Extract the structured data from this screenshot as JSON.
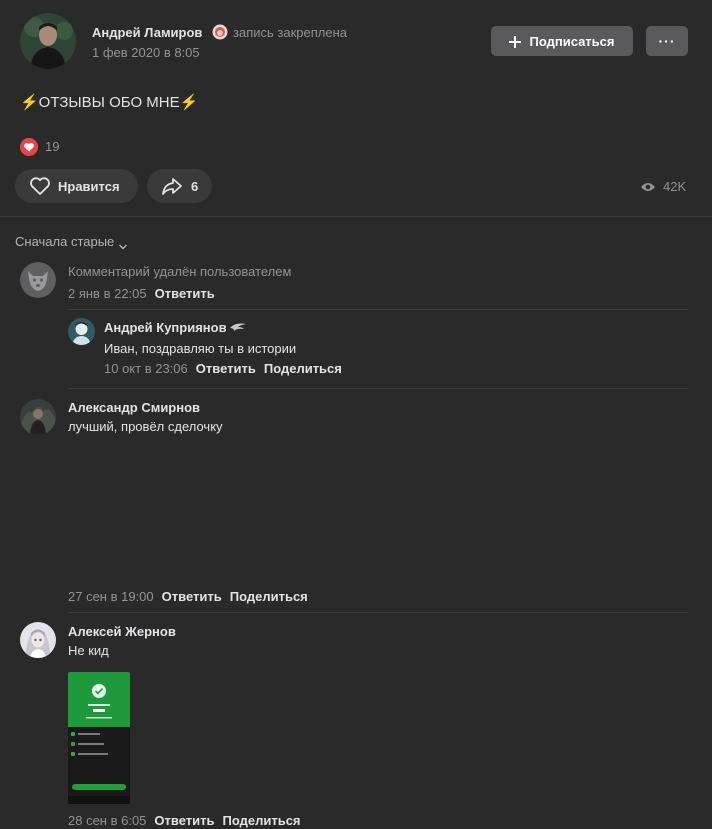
{
  "post": {
    "author": "Андрей Ламиров",
    "pinned_label": "запись закреплена",
    "date": "1 фев 2020 в 8:05",
    "text": "⚡ОТЗЫВЫ ОБО МНЕ⚡",
    "reactions_count": "19",
    "subscribe_label": "Подписаться",
    "more_label": "···",
    "like_label": "Нравится",
    "share_count": "6",
    "views": "42K"
  },
  "sort_label": "Сначала старые",
  "comments": [
    {
      "author": "",
      "text": "Комментарий удалён пользователем",
      "date": "2 янв в 22:05",
      "reply": "Ответить"
    },
    {
      "author": "Андрей Куприянов",
      "text": "Иван, поздравляю ты в истории",
      "date": "10 окт в 23:06",
      "reply": "Ответить",
      "share": "Поделиться"
    },
    {
      "author": "Александр Смирнов",
      "text": "лучший, провёл сделочку",
      "date": "27 сен в 19:00",
      "reply": "Ответить",
      "share": "Поделиться"
    },
    {
      "author": "Алексей Жернов",
      "text": "Не кид",
      "date": "28 сен в 6:05",
      "reply": "Ответить",
      "share": "Поделиться"
    }
  ],
  "colors": {
    "background": "#2a2a2b",
    "button": "#5a5a5c",
    "heart": "#e64646",
    "green": "#21a038"
  }
}
